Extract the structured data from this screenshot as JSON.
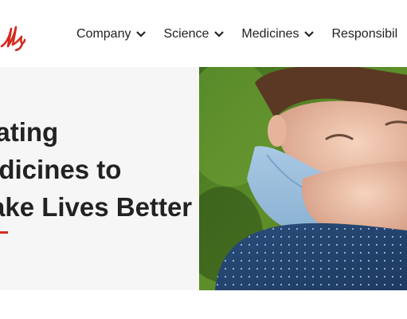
{
  "brand": {
    "logo_text": "Lilly",
    "accent_color": "#d52b1e"
  },
  "nav": {
    "items": [
      {
        "label": "Company",
        "icon": "chevron-down-icon"
      },
      {
        "label": "Science",
        "icon": "chevron-down-icon"
      },
      {
        "label": "Medicines",
        "icon": "chevron-down-icon"
      },
      {
        "label": "Responsibil"
      }
    ]
  },
  "hero": {
    "title_lines": [
      "eating",
      "edicines to",
      "ake Lives Better"
    ],
    "image": "child-hugging-photo"
  }
}
